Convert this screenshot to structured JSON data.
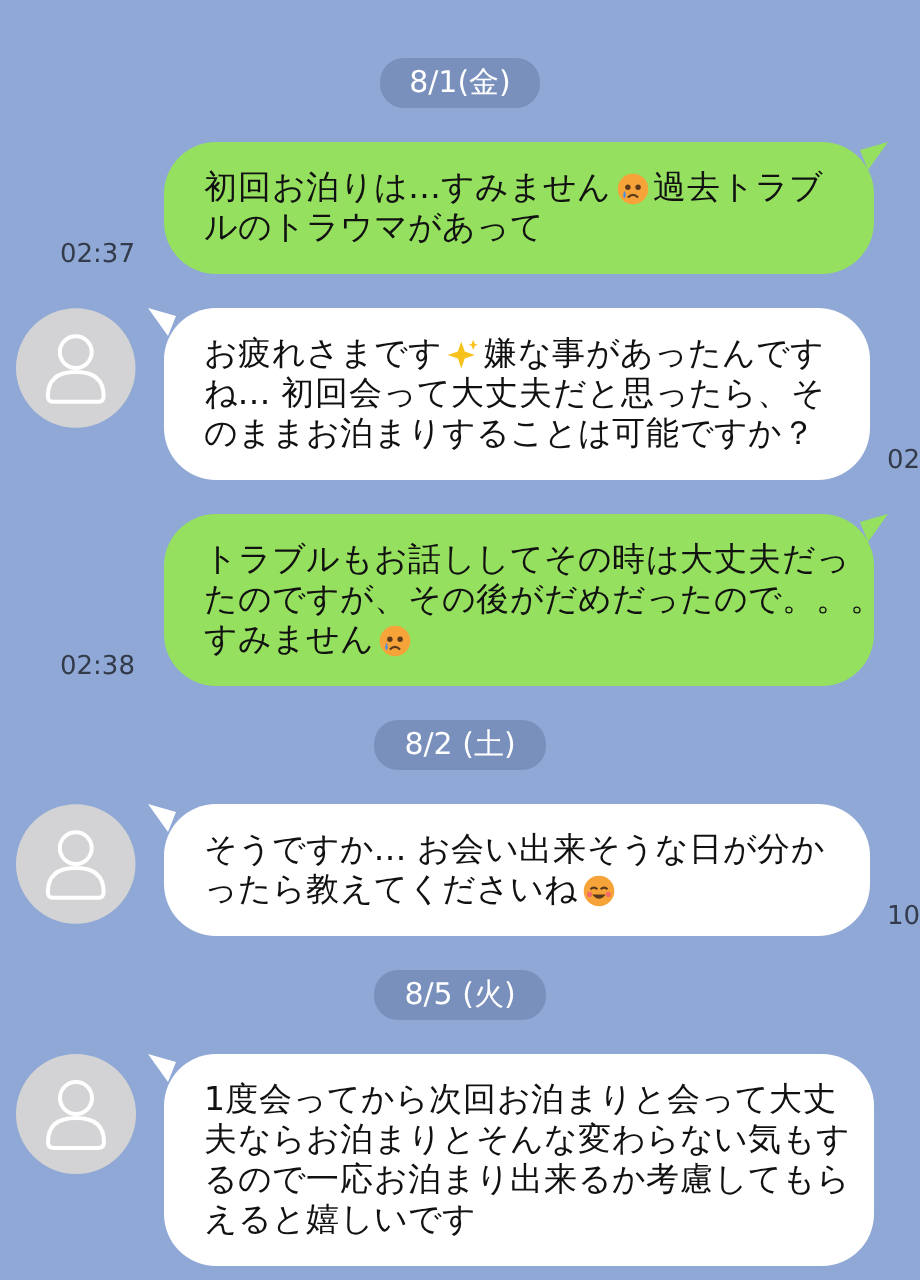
{
  "messages": [
    {
      "kind": "date",
      "text": "8/1(金)"
    },
    {
      "kind": "sent",
      "time": "02:37",
      "lines": [
        [
          {
            "kind": "text",
            "text": "初回お泊りは…すみません"
          },
          {
            "kind": "tearful"
          },
          {
            "kind": "text",
            "text": "過去トラブ"
          }
        ],
        [
          {
            "kind": "text",
            "text": "ルのトラウマがあって"
          }
        ]
      ]
    },
    {
      "kind": "received",
      "time": "02",
      "lines": [
        [
          {
            "kind": "text",
            "text": "お疲れさまです"
          },
          {
            "kind": "sparkle"
          },
          {
            "kind": "text",
            "text": "嫌な事があったんです"
          }
        ],
        [
          {
            "kind": "text",
            "text": "ね… 初回会って大丈夫だと思ったら、そ"
          }
        ],
        [
          {
            "kind": "text",
            "text": "のままお泊まりすることは可能ですか？"
          }
        ]
      ]
    },
    {
      "kind": "sent",
      "time": "02:38",
      "lines": [
        [
          {
            "kind": "text",
            "text": "トラブルもお話ししてその時は大丈夫だっ"
          }
        ],
        [
          {
            "kind": "text",
            "text": "たのですが、その後がだめだったので。。。"
          }
        ],
        [
          {
            "kind": "text",
            "text": "すみません"
          },
          {
            "kind": "tearful"
          }
        ]
      ]
    },
    {
      "kind": "date",
      "text": "8/2 (土)"
    },
    {
      "kind": "received",
      "time": "10",
      "lines": [
        [
          {
            "kind": "text",
            "text": "そうですか… お会い出来そうな日が分か"
          }
        ],
        [
          {
            "kind": "text",
            "text": "ったら教えてくださいね"
          },
          {
            "kind": "smiling"
          }
        ]
      ]
    },
    {
      "kind": "date",
      "text": "8/5 (火)"
    },
    {
      "kind": "received",
      "lines": [
        [
          {
            "kind": "text",
            "text": "1度会ってから次回お泊まりと会って大丈"
          }
        ],
        [
          {
            "kind": "text",
            "text": "夫ならお泊まりとそんな変わらない気もす"
          }
        ],
        [
          {
            "kind": "text",
            "text": "るので一応お泊まり出来るか考慮してもら"
          }
        ],
        [
          {
            "kind": "text",
            "text": "えると嬉しいです"
          }
        ]
      ]
    }
  ]
}
